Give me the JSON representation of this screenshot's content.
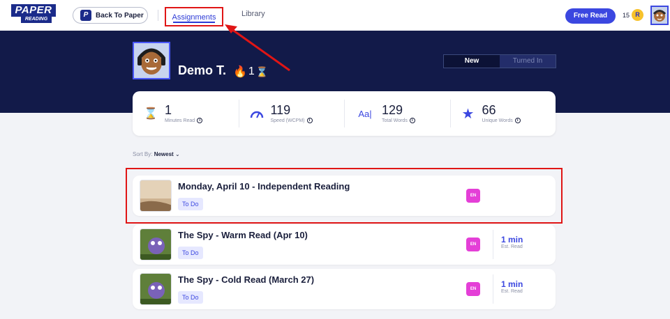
{
  "header": {
    "logo_line1": "PAPER",
    "logo_line2": "READING",
    "back_label": "Back To Paper",
    "back_badge": "P",
    "nav": {
      "assignments": "Assignments",
      "library": "Library"
    },
    "free_read": "Free Read",
    "coins": "15",
    "coin_letter": "R"
  },
  "profile": {
    "name": "Demo T.",
    "streak": "1",
    "toggle": {
      "new": "New",
      "turned_in": "Turned In"
    }
  },
  "stats": [
    {
      "value": "1",
      "label": "Minutes Read",
      "icon": "hourglass-icon"
    },
    {
      "value": "119",
      "label": "Speed (WCPM)",
      "icon": "speedometer-icon"
    },
    {
      "value": "129",
      "label": "Total Words",
      "icon": "text-icon"
    },
    {
      "value": "66",
      "label": "Unique Words",
      "icon": "star-icon"
    }
  ],
  "sort": {
    "label": "Sort By:",
    "value": "Newest"
  },
  "assignments": [
    {
      "title": "Monday, April 10 - Independent Reading",
      "status": "To Do",
      "lang": "EN",
      "est": "",
      "est_label": ""
    },
    {
      "title": "The Spy - Warm Read (Apr 10)",
      "status": "To Do",
      "lang": "EN",
      "est": "1 min",
      "est_label": "Est. Read"
    },
    {
      "title": "The Spy - Cold Read (March 27)",
      "status": "To Do",
      "lang": "EN",
      "est": "1 min",
      "est_label": "Est. Read"
    }
  ],
  "colors": {
    "brand": "#1b2b8a",
    "accent": "#3b47e0",
    "banner": "#121a49",
    "lang_badge": "#e43fd7",
    "highlight": "#e01515"
  }
}
